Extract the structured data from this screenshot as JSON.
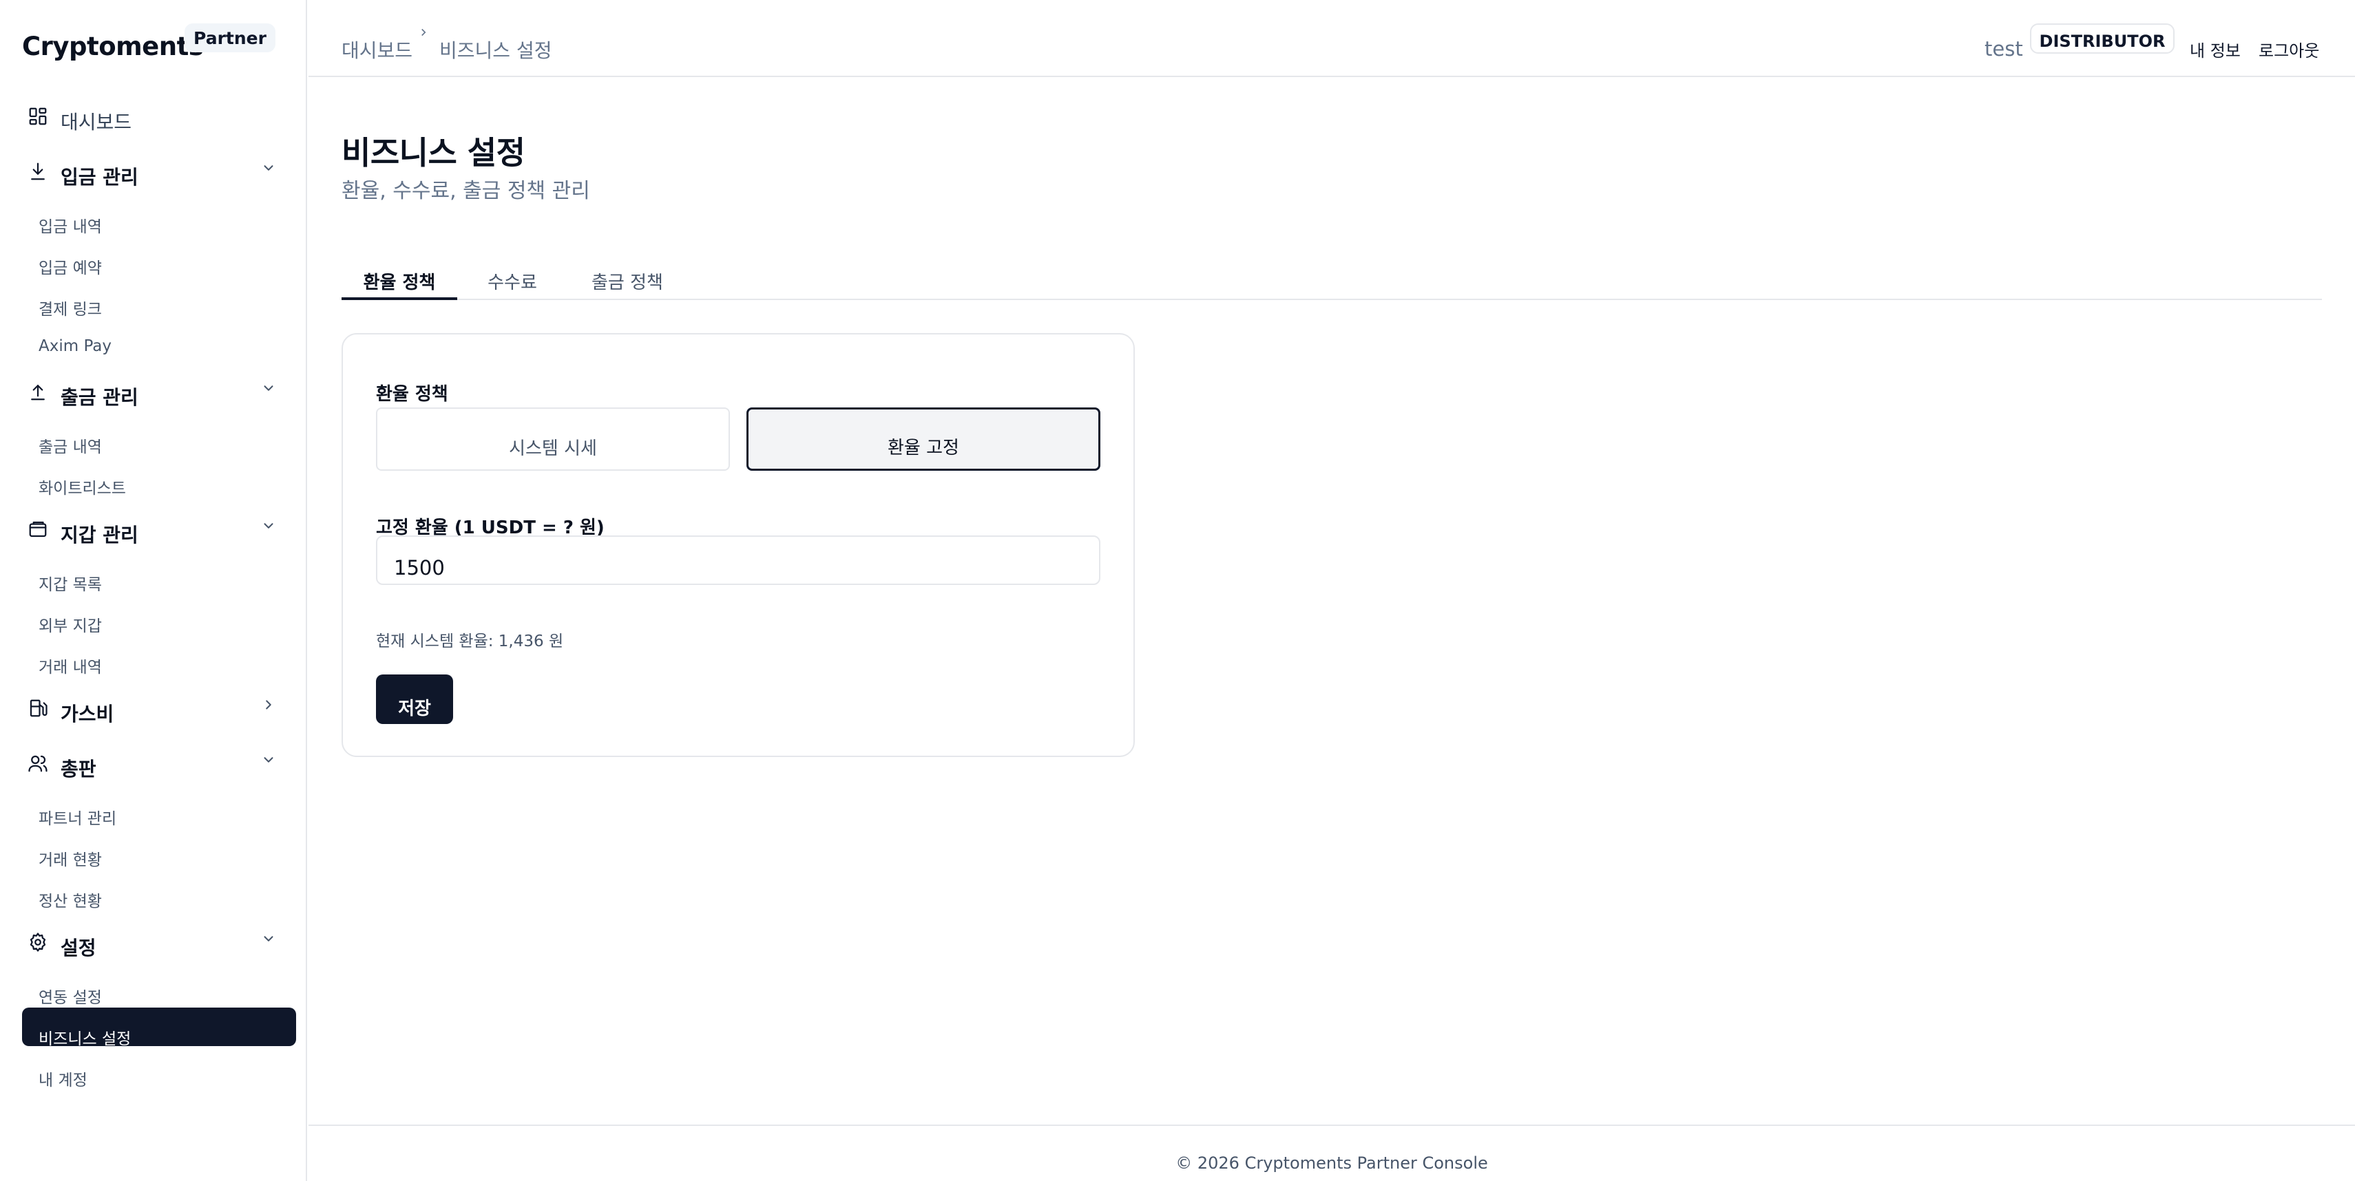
{
  "sidebar": {
    "brand": "Cryptoments",
    "badge": "Partner",
    "dashboard": "대시보드",
    "deposit": {
      "label": "입금 관리",
      "items": [
        "입금 내역",
        "입금 예약",
        "결제 링크",
        "Axim Pay"
      ]
    },
    "withdraw": {
      "label": "출금 관리",
      "items": [
        "출금 내역",
        "화이트리스트"
      ]
    },
    "wallet": {
      "label": "지갑 관리",
      "items": [
        "지갑 목록",
        "외부 지갑",
        "거래 내역"
      ]
    },
    "gas": {
      "label": "가스비"
    },
    "distributor": {
      "label": "총판",
      "items": [
        "파트너 관리",
        "거래 현황",
        "정산 현황"
      ]
    },
    "settings": {
      "label": "설정",
      "items": [
        "연동 설정",
        "비즈니스 설정",
        "내 계정"
      ],
      "active_index": 1
    }
  },
  "header": {
    "breadcrumb": [
      "대시보드",
      "비즈니스 설정"
    ],
    "user": "test",
    "role": "DISTRIBUTOR",
    "my_info": "내 정보",
    "logout": "로그아웃"
  },
  "page": {
    "title": "비즈니스 설정",
    "subtitle": "환율, 수수료, 출금 정책 관리"
  },
  "tabs": [
    "환율 정책",
    "수수료",
    "출금 정책"
  ],
  "active_tab": 0,
  "form": {
    "policy_label": "환율 정책",
    "options": [
      "시스템 시세",
      "환율 고정"
    ],
    "selected_option": 1,
    "fixed_rate_label": "고정 환율 (1 USDT = ? 원)",
    "fixed_rate_value": "1500",
    "current_rate_hint": "현재 시스템 환율: 1,436 원",
    "save_label": "저장"
  },
  "footer": {
    "text": "© 2026 Cryptoments Partner Console"
  },
  "colors": {
    "primary": "#0f172a",
    "muted": "#64748b",
    "border": "#e5e7eb"
  }
}
